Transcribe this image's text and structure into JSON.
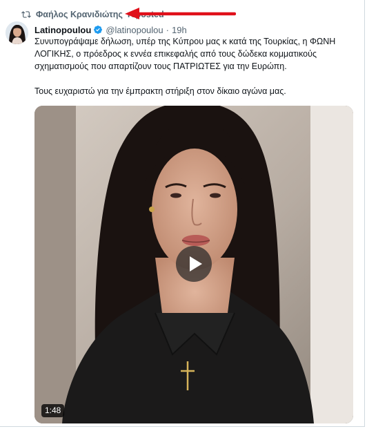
{
  "repost": {
    "user": "Φαήλος Κρανιδιώτης",
    "label": "reposted"
  },
  "author": {
    "name": "Latinopoulou",
    "handle": "@latinopoulou",
    "separator": "·",
    "time": "19h",
    "verified": true,
    "verified_color": "#1d9bf0"
  },
  "tweet": {
    "paragraph_1": "Συνυπογράψαμε δήλωση, υπέρ της Κύπρου μας κ κατά της Τουρκίας, η ΦΩΝΗ ΛΟΓΙΚΗΣ, ο πρόεδρος κ εννέα επικεφαλής από τους δώδεκα κομματικούς σχηματισμούς που απαρτίζουν τους ΠΑΤΡΙΩΤΕΣ για την Ευρώπη.",
    "paragraph_2": "Τους ευχαριστώ για την έμπρακτη στήριξη στον δίκαιο αγώνα μας."
  },
  "media": {
    "type": "video",
    "duration": "1:48",
    "play_icon": "play-icon"
  },
  "annotation": {
    "arrow_color": "#e0101a"
  },
  "colors": {
    "text": "#0f1419",
    "secondary": "#536471",
    "accent": "#1d9bf0",
    "border": "#cfd9de"
  }
}
